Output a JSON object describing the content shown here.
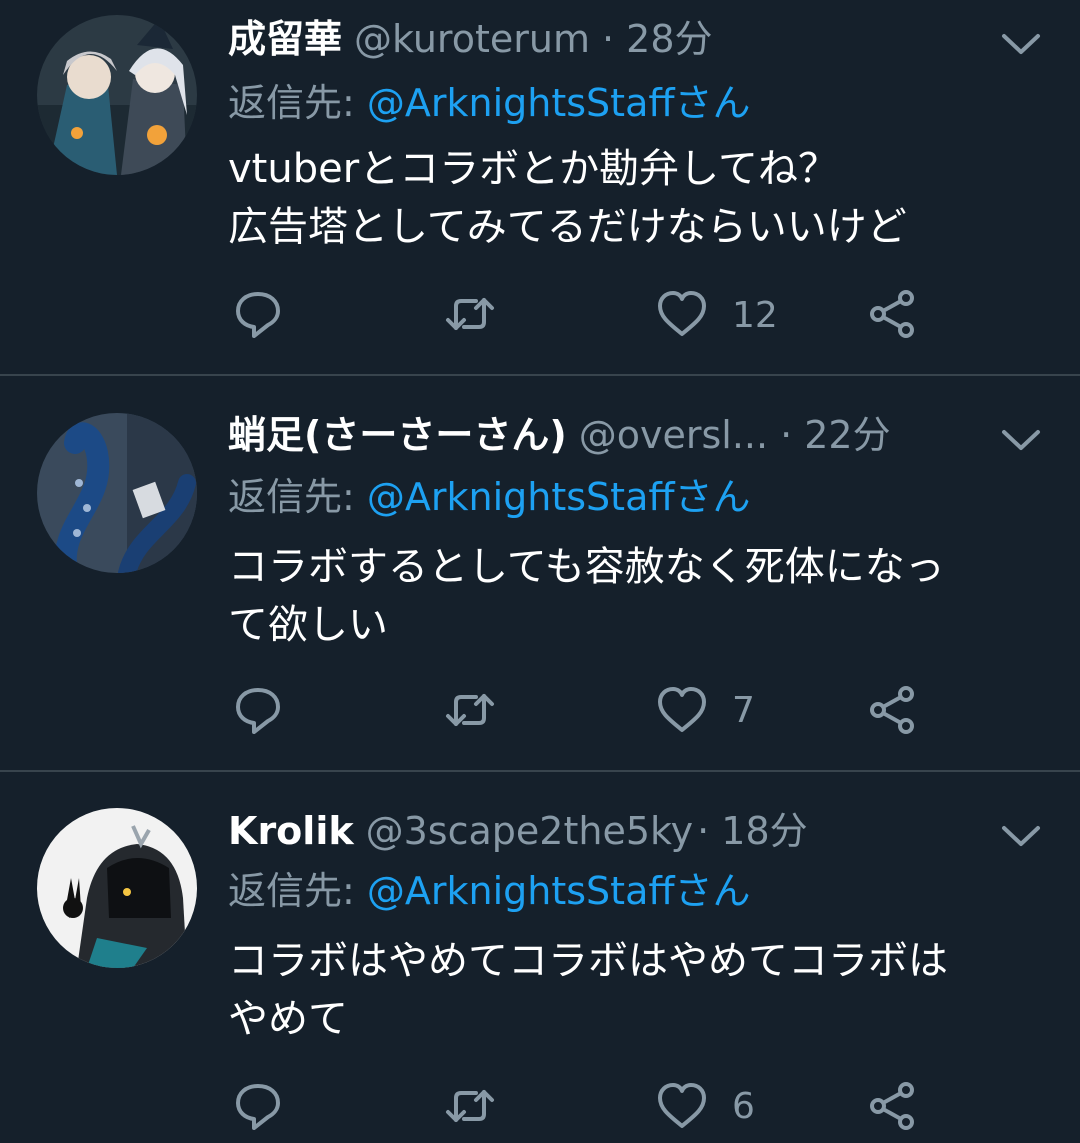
{
  "colors": {
    "background": "#15202b",
    "text": "#ffffff",
    "secondary": "#8899a6",
    "link": "#1da1f2",
    "divider": "#38444d"
  },
  "tweets": [
    {
      "name": "成留華",
      "handle": "@kuroterum",
      "time": "· 28分",
      "reply_label": "返信先: ",
      "reply_mention": "@ArknightsStaffさん",
      "text_lines": [
        "vtuberとコラボとか勘弁してね？",
        "広告塔としてみてるだけならいいけど"
      ],
      "like_count": "12",
      "icons": [
        "reply-icon",
        "retweet-icon",
        "like-icon",
        "share-icon",
        "chevron-down-icon"
      ]
    },
    {
      "name": "蛸足(さーさーさん)",
      "handle": "@oversl...",
      "time": " · 22分",
      "reply_label": "返信先: ",
      "reply_mention": "@ArknightsStaffさん",
      "text_lines": [
        "コラボするとしても容赦なく死体になっ",
        "て欲しい"
      ],
      "like_count": "7",
      "icons": [
        "reply-icon",
        "retweet-icon",
        "like-icon",
        "share-icon",
        "chevron-down-icon"
      ]
    },
    {
      "name": "Krolik",
      "handle": "@3scape2the5ky",
      "time": " · 18分",
      "reply_label": "返信先: ",
      "reply_mention": "@ArknightsStaffさん",
      "text_lines": [
        "コラボはやめてコラボはやめてコラボは",
        "やめて"
      ],
      "like_count": "6",
      "icons": [
        "reply-icon",
        "retweet-icon",
        "like-icon",
        "share-icon",
        "chevron-down-icon"
      ]
    }
  ]
}
